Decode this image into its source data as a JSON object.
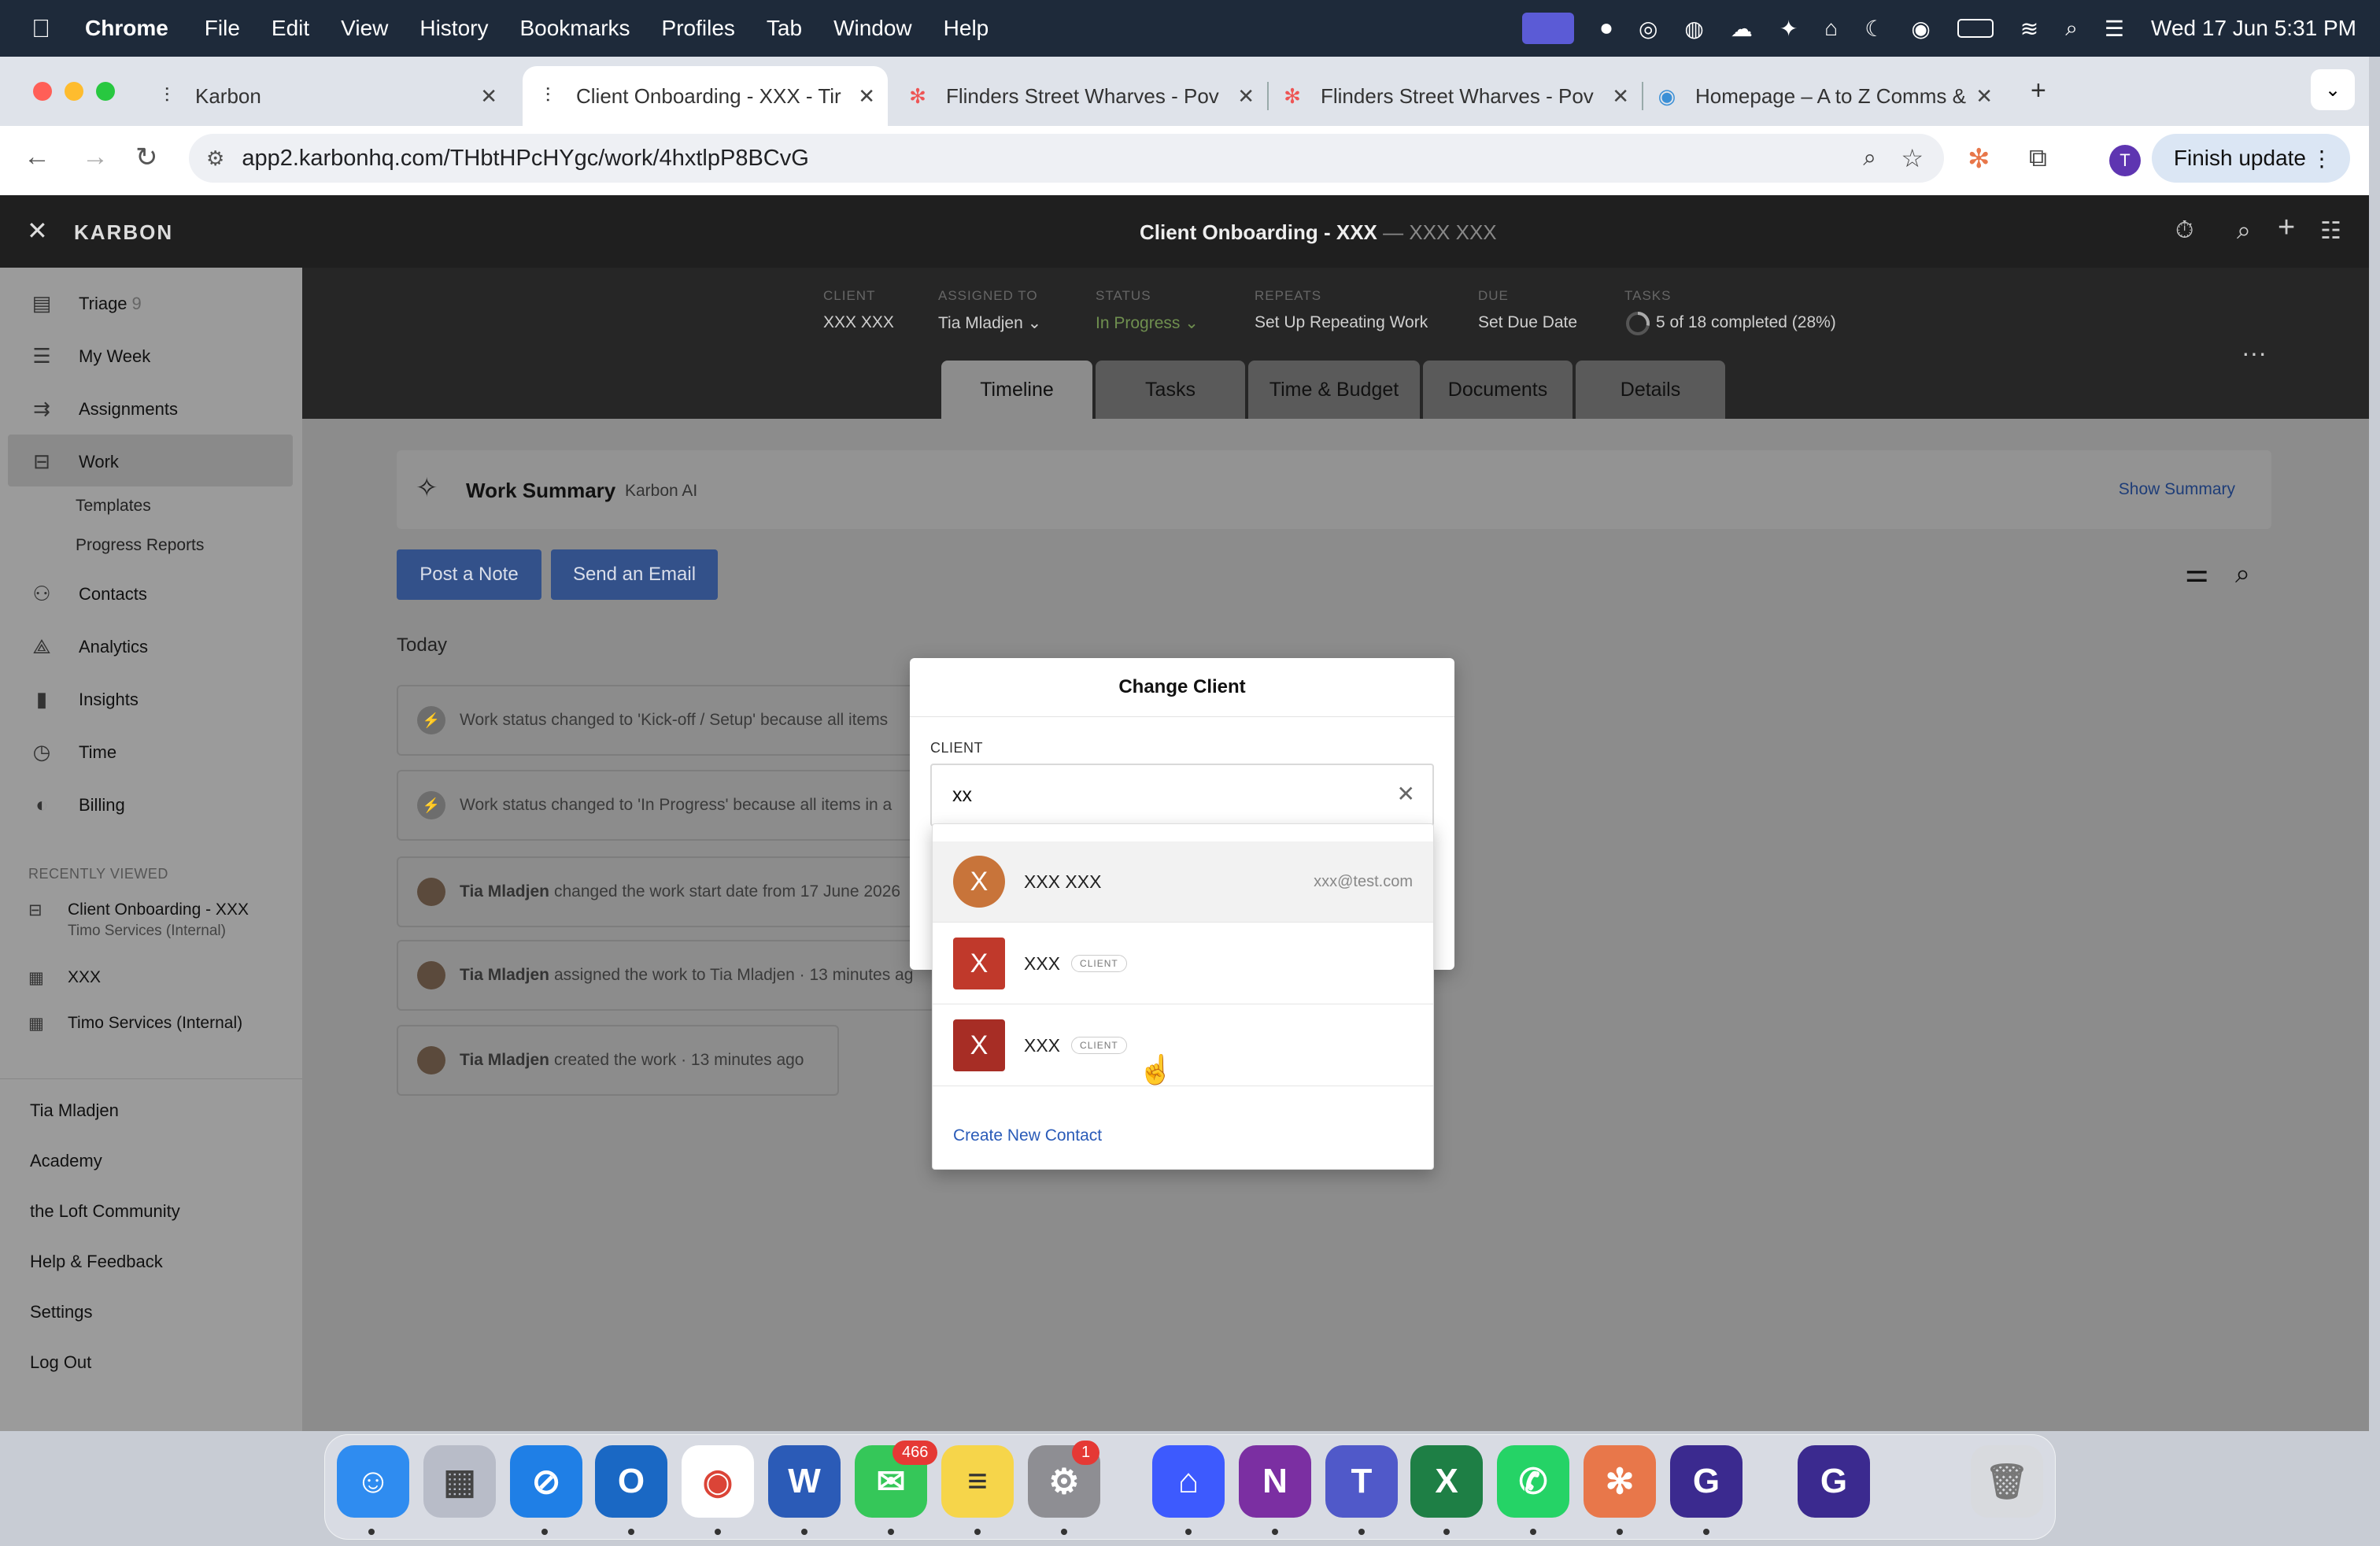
{
  "menubar": {
    "app": "Chrome",
    "menus": [
      "File",
      "Edit",
      "View",
      "History",
      "Bookmarks",
      "Profiles",
      "Tab",
      "Window",
      "Help"
    ],
    "clock": "Wed 17 Jun  5:31 PM"
  },
  "browser": {
    "tabs": [
      {
        "title": "Karbon"
      },
      {
        "title": "Client Onboarding - XXX - Tir"
      },
      {
        "title": "Flinders Street Wharves - Pov"
      },
      {
        "title": "Flinders Street Wharves - Pov"
      },
      {
        "title": "Homepage – A to Z Comms &"
      }
    ],
    "url": "app2.karbonhq.com/THbtHPcHYgc/work/4hxtlpP8BCvG",
    "profile_initial": "T",
    "finish_update": "Finish update"
  },
  "app": {
    "brand": "KARBON",
    "header_title": "Client Onboarding - XXX",
    "header_subtitle": "— XXX XXX"
  },
  "sidebar": {
    "items": [
      {
        "label": "Triage",
        "count": "9"
      },
      {
        "label": "My Week"
      },
      {
        "label": "Assignments"
      },
      {
        "label": "Work"
      },
      {
        "label": "Templates"
      },
      {
        "label": "Progress Reports"
      },
      {
        "label": "Contacts"
      },
      {
        "label": "Analytics"
      },
      {
        "label": "Insights"
      },
      {
        "label": "Time"
      },
      {
        "label": "Billing"
      }
    ],
    "recent_heading": "RECENTLY VIEWED",
    "recent": [
      {
        "title": "Client Onboarding - XXX",
        "sub": "Timo Services (Internal)"
      },
      {
        "title": "XXX"
      },
      {
        "title": "Timo Services (Internal)"
      }
    ],
    "footer": [
      "Tia Mladjen",
      "Academy",
      "the Loft Community",
      "Help & Feedback",
      "Settings",
      "Log Out"
    ]
  },
  "work": {
    "meta": {
      "client_label": "CLIENT",
      "client": "XXX XXX",
      "assigned_label": "ASSIGNED TO",
      "assigned": "Tia Mladjen",
      "status_label": "STATUS",
      "status": "In Progress",
      "repeats_label": "REPEATS",
      "repeats": "Set Up Repeating Work",
      "due_label": "DUE",
      "due": "Set Due Date",
      "tasks_label": "TASKS",
      "tasks": "5 of 18 completed (28%)",
      "tasks_progress": 0.28
    },
    "tabs": [
      "Timeline",
      "Tasks",
      "Time & Budget",
      "Documents",
      "Details"
    ],
    "summary_title": "Work Summary",
    "summary_sub": "Karbon AI",
    "show_summary": "Show Summary",
    "post_note": "Post a Note",
    "send_email": "Send an Email",
    "day_heading": "Today",
    "timeline": [
      {
        "actor": "",
        "text": "Work status changed to 'Kick-off / Setup' because all items"
      },
      {
        "actor": "",
        "text": "Work status changed to 'In Progress' because all items in a"
      },
      {
        "actor": "Tia Mladjen",
        "text": "changed the work start date from 17 June 2026"
      },
      {
        "actor": "Tia Mladjen",
        "text": "assigned the work to Tia Mladjen · 13 minutes ag"
      },
      {
        "actor": "Tia Mladjen",
        "text": "created the work · 13 minutes ago"
      }
    ]
  },
  "modal": {
    "title": "Change Client",
    "field_label": "CLIENT",
    "input_value": "xx",
    "options": [
      {
        "initial": "X",
        "name": "XXX XXX",
        "email": "xxx@test.com",
        "color": "#c8743a"
      },
      {
        "initial": "X",
        "name": "XXX",
        "badge": "CLIENT",
        "color": "#c0392b"
      },
      {
        "initial": "X",
        "name": "XXX",
        "badge": "CLIENT",
        "color": "#a72d25"
      }
    ],
    "create_new": "Create New Contact"
  },
  "dock": {
    "messages_badge": "466",
    "settings_badge": "1"
  }
}
